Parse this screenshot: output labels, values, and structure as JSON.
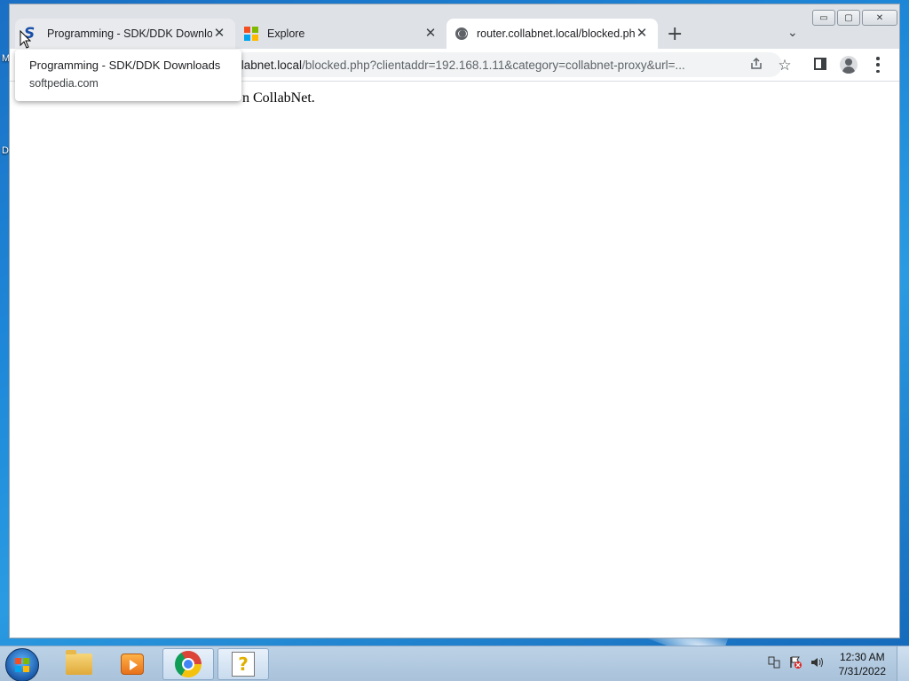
{
  "desktop": {
    "fragments": [
      "M",
      "D"
    ]
  },
  "window": {
    "controls": {
      "minimize": "▭",
      "maximize": "▢",
      "close": "✕"
    }
  },
  "tabs": [
    {
      "title": "Programming - SDK/DDK Downloads - Softpedia",
      "icon": "softpedia-favicon",
      "close": "✕"
    },
    {
      "title": "Explore",
      "icon": "microsoft-favicon",
      "close": "✕"
    },
    {
      "title": "router.collabnet.local/blocked.php",
      "icon": "globe-favicon",
      "close": "✕",
      "active": true
    }
  ],
  "toolbar": {
    "new_tab": "+",
    "tab_search": "⌄",
    "url_host": "r.collabnet.local",
    "url_rest": "/blocked.php?clientaddr=192.168.1.11&category=collabnet-proxy&url=...",
    "share_icon": "share-icon",
    "bookmark_icon": "☆"
  },
  "hovercard": {
    "title": "Programming - SDK/DDK Downloads",
    "domain": "softpedia.com"
  },
  "page": {
    "text": "n CollabNet."
  },
  "taskbar": {
    "apps": [
      "file-explorer",
      "media-player",
      "chrome",
      "help"
    ],
    "clock_time": "12:30 AM",
    "clock_date": "7/31/2022"
  },
  "colors": {
    "chrome_frame": "#dee1e6",
    "omnibox": "#f1f3f4",
    "taskbar": "#bcd2e6"
  }
}
